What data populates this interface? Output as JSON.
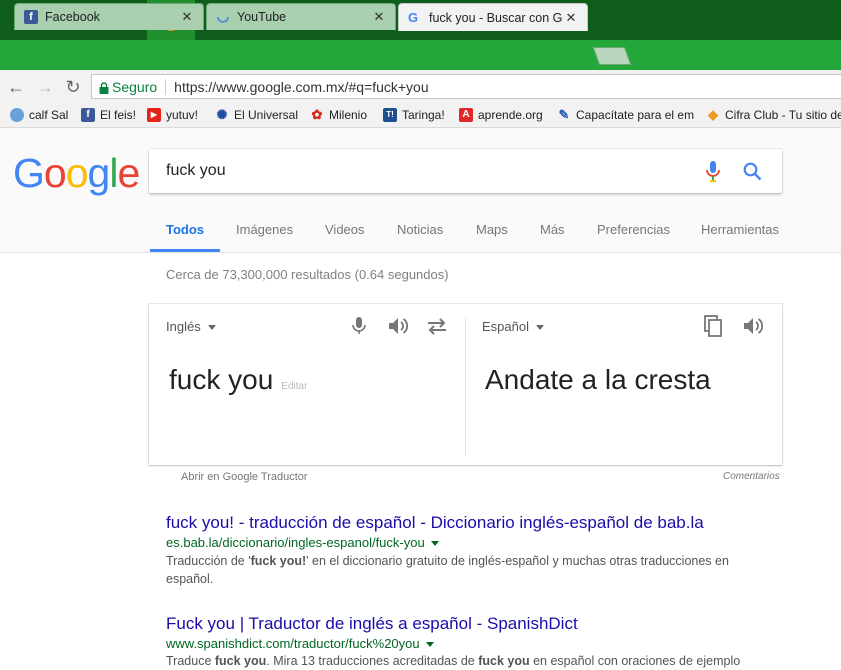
{
  "browser": {
    "tabs": [
      {
        "title": "Facebook",
        "icon": "facebook-icon"
      },
      {
        "title": "YouTube",
        "icon": "loading-spinner-icon"
      },
      {
        "title": "fuck you - Buscar con Go",
        "icon": "google-g-icon"
      }
    ],
    "secure_label": "Seguro",
    "url": "https://www.google.com.mx/#q=fuck+you",
    "bookmarks": [
      {
        "label": "calf Sal",
        "color": "#6aa0d8"
      },
      {
        "label": "El feis!",
        "color": "#3b5998",
        "glyph": "f"
      },
      {
        "label": "yutuv!",
        "color": "#e62117",
        "glyph": "▶"
      },
      {
        "label": "El Universal",
        "color": "#1a4fa0",
        "glyph": "✺"
      },
      {
        "label": "Milenio",
        "color": "#d6271c",
        "glyph": "✿"
      },
      {
        "label": "Taringa!",
        "color": "#1d4f91",
        "glyph": "T!"
      },
      {
        "label": "aprende.org",
        "color": "#e02828",
        "glyph": "A"
      },
      {
        "label": "Capacítate para el em",
        "color": "#2b5fb5",
        "glyph": "✎"
      },
      {
        "label": "Cifra Club - Tu sitio de",
        "color": "#f29a1f",
        "glyph": "◆"
      }
    ]
  },
  "google": {
    "query": "fuck you",
    "tabs": [
      "Todos",
      "Imágenes",
      "Videos",
      "Noticias",
      "Maps",
      "Más",
      "Preferencias",
      "Herramientas"
    ],
    "stats": "Cerca de 73,300,000 resultados (0.64 segundos)"
  },
  "translate": {
    "source_lang": "Inglés",
    "target_lang": "Español",
    "source_text": "fuck you",
    "edit_label": "Editar",
    "target_text": "Andate a la cresta",
    "open_link": "Abrir en Google Traductor",
    "feedback": "Comentarios"
  },
  "results": [
    {
      "title": "fuck you! - traducción de español - Diccionario inglés-español de bab.la",
      "url": "es.bab.la/diccionario/ingles-espanol/fuck-you",
      "snippet_pre": "Traducción de '",
      "snippet_bold": "fuck you!",
      "snippet_post": "' en el diccionario gratuito de inglés-español y muchas otras traducciones en español."
    },
    {
      "title": "Fuck you | Traductor de inglés a español - SpanishDict",
      "url": "www.spanishdict.com/traductor/fuck%20you",
      "snippet_pre": "Traduce ",
      "snippet_bold": "fuck you",
      "snippet_mid": ". Mira 13 traducciones acreditadas de ",
      "snippet_bold2": "fuck you",
      "snippet_post": " en español con oraciones de ejemplo"
    }
  ],
  "colors": {
    "taskbar": "#0f5d1a",
    "tabstrip": "#23a63a",
    "link": "#1a0dab",
    "url_green": "#006621",
    "accent": "#4285f4"
  }
}
